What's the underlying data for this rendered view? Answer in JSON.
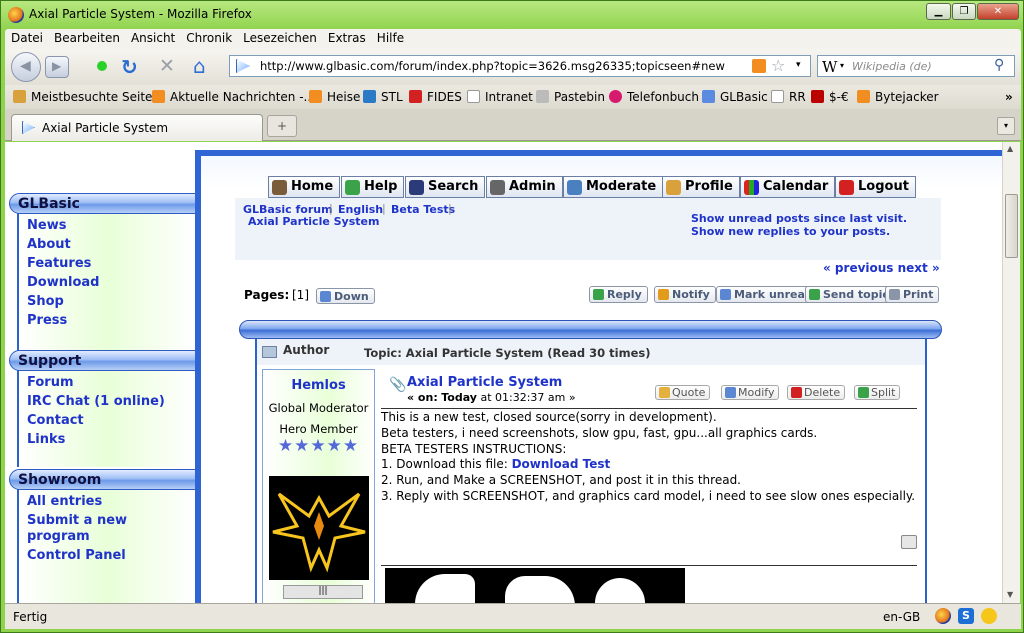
{
  "window": {
    "title": "Axial Particle System - Mozilla Firefox"
  },
  "menu": [
    "Datei",
    "Bearbeiten",
    "Ansicht",
    "Chronik",
    "Lesezeichen",
    "Extras",
    "Hilfe"
  ],
  "nav": {
    "url": "http://www.glbasic.com/forum/index.php?topic=3626.msg26335;topicseen#new",
    "search_placeholder": "Wikipedia (de)"
  },
  "bookmarks": [
    "Meistbesuchte Seiten",
    "Aktuelle Nachrichten -...",
    "Heise",
    "STL",
    "FIDES",
    "Intranet",
    "Pastebin",
    "Telefonbuch",
    "GLBasic",
    "RR",
    "$-€",
    "Bytejacker"
  ],
  "tab": {
    "label": "Axial Particle System"
  },
  "status": {
    "text": "Fertig",
    "locale": "en-GB"
  },
  "sidebar": {
    "glbasic": {
      "title": "GLBasic",
      "links": [
        "News",
        "About",
        "Features",
        "Download",
        "Shop",
        "Press"
      ]
    },
    "support": {
      "title": "Support",
      "links": [
        "Forum",
        "IRC Chat (1 online)",
        "Contact",
        "Links"
      ]
    },
    "showroom": {
      "title": "Showroom",
      "links": [
        "All entries",
        "Submit a new program",
        "Control Panel"
      ]
    }
  },
  "toolbar": [
    "Home",
    "Help",
    "Search",
    "Admin",
    "Moderate",
    "Profile",
    "Calendar",
    "Logout"
  ],
  "breadcrumb": {
    "items": [
      "GLBasic forum",
      "English",
      "Beta Tests"
    ],
    "current": "Axial Particle System"
  },
  "unread": {
    "line1": "Show unread posts since last visit.",
    "line2": "Show new replies to your posts."
  },
  "prevnext": "« previous next »",
  "pages": {
    "label": "Pages:",
    "current": "[1]",
    "down": "Down"
  },
  "actions": [
    "Reply",
    "Notify",
    "Mark unread",
    "Send topic",
    "Print"
  ],
  "thread": {
    "author_label": "Author",
    "topic_label": "Topic: Axial Particle System  (Read 30 times)"
  },
  "user": {
    "name": "Hemlos",
    "role": "Global Moderator",
    "rank": "Hero Member",
    "stars": "★★★★★"
  },
  "post": {
    "title": "Axial Particle System",
    "date_prefix": "« on:",
    "date_day": "Today",
    "date_time": "at 01:32:37 am »",
    "buttons": [
      "Quote",
      "Modify",
      "Delete",
      "Split"
    ],
    "lines": [
      "This is a new test, closed source(sorry in development).",
      "Beta testers, i need screenshots, slow gpu, fast, gpu...all graphics cards.",
      "BETA TESTERS INSTRUCTIONS:",
      "2. Run, and Make a SCREENSHOT, and post it in this thread.",
      "3. Reply with SCREENSHOT, and graphics card model, i need to see slow ones especially."
    ],
    "step1_prefix": "1. Download this file:",
    "step1_link": "Download Test"
  }
}
